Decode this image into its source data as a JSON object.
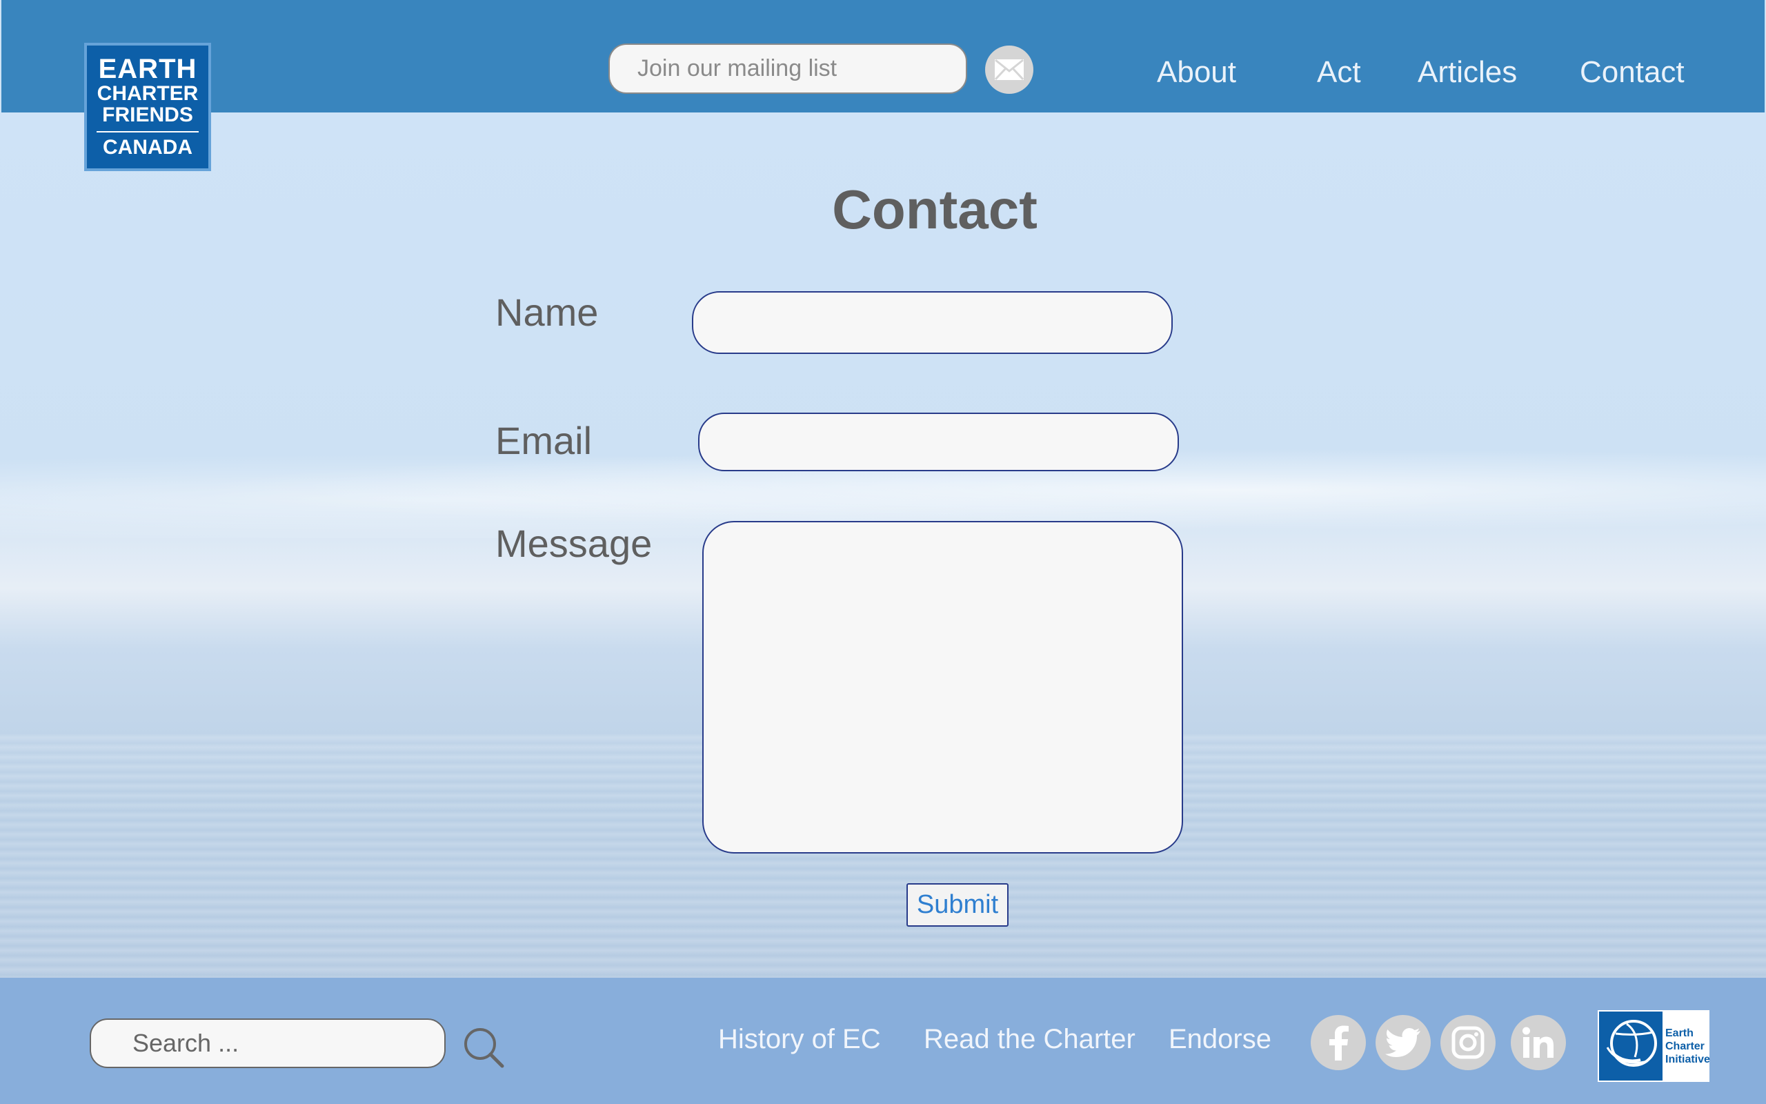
{
  "header": {
    "logo": {
      "line1": "EARTH",
      "line2": "CHARTER",
      "line3": "FRIENDS",
      "line4": "CANADA"
    },
    "mailing_list": {
      "placeholder": "Join our mailing list",
      "value": ""
    },
    "mail_button_icon": "envelope-icon",
    "nav": [
      "About",
      "Act",
      "Articles",
      "Contact"
    ]
  },
  "main": {
    "title": "Contact",
    "form": {
      "name_label": "Name",
      "email_label": "Email",
      "message_label": "Message",
      "name_value": "",
      "email_value": "",
      "message_value": "",
      "submit_label": "Submit"
    }
  },
  "footer": {
    "search": {
      "placeholder": "Search ...",
      "value": ""
    },
    "links": [
      "History of EC",
      "Read the Charter",
      "Endorse"
    ],
    "social": [
      "facebook-icon",
      "twitter-icon",
      "instagram-icon",
      "linkedin-icon"
    ],
    "partner_logo": {
      "line1": "Earth",
      "line2": "Charter",
      "line3": "Initiative"
    }
  },
  "colors": {
    "header": "#3985be",
    "footer": "#88aedb",
    "field_border": "#283b8a",
    "submit_text": "#2f7fd0",
    "logo_bg": "#0d5fa8"
  }
}
